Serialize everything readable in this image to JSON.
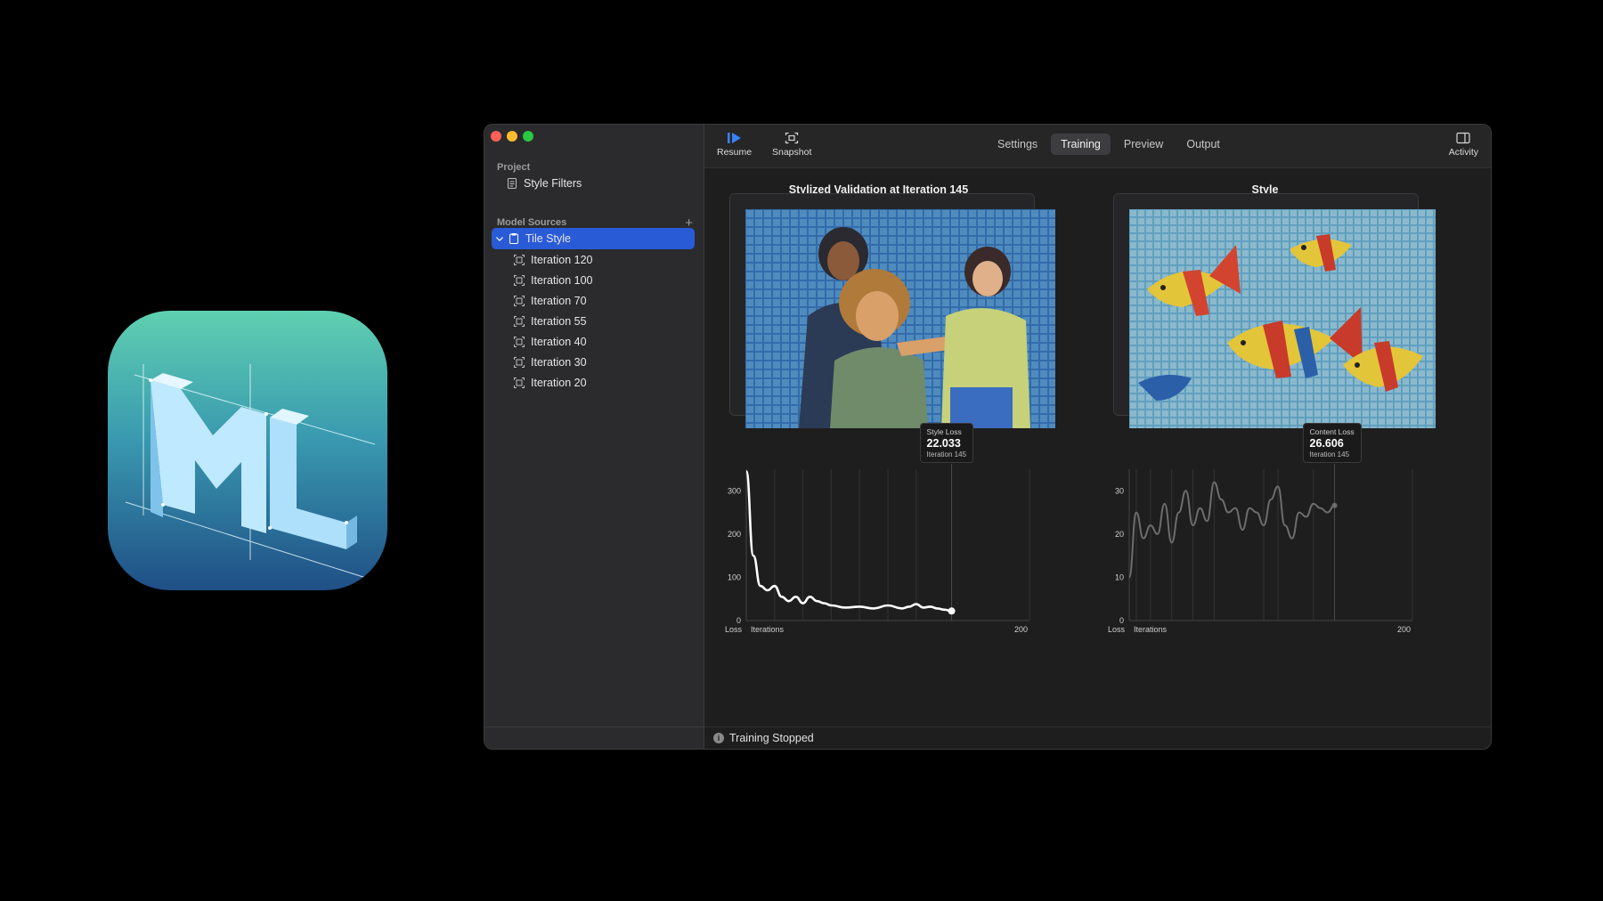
{
  "sidebar": {
    "project_header": "Project",
    "project_item": "Style Filters",
    "sources_header": "Model Sources",
    "selected_source": "Tile Style",
    "iterations": [
      "Iteration 120",
      "Iteration 100",
      "Iteration 70",
      "Iteration 55",
      "Iteration 40",
      "Iteration 30",
      "Iteration 20"
    ]
  },
  "toolbar": {
    "resume_label": "Resume",
    "snapshot_label": "Snapshot",
    "activity_label": "Activity",
    "tabs": [
      "Settings",
      "Training",
      "Preview",
      "Output"
    ],
    "active_tab": "Training",
    "accent": "#2a5bd7"
  },
  "panes": {
    "left_title": "Stylized Validation at Iteration 145",
    "right_title": "Style"
  },
  "chart_data": [
    {
      "type": "line",
      "title": "",
      "xlabel": "Iterations",
      "ylabel": "Loss",
      "xlim": [
        0,
        200
      ],
      "ylim": [
        0,
        350
      ],
      "yticks": [
        0,
        100,
        200,
        300
      ],
      "x_end_label": "200",
      "series": [
        {
          "name": "Style Loss",
          "x": [
            0,
            5,
            10,
            15,
            20,
            25,
            30,
            35,
            40,
            45,
            50,
            55,
            60,
            70,
            80,
            90,
            100,
            110,
            115,
            120,
            125,
            130,
            135,
            140,
            145
          ],
          "y": [
            345,
            150,
            80,
            70,
            80,
            55,
            45,
            55,
            40,
            55,
            45,
            40,
            35,
            30,
            32,
            28,
            35,
            28,
            32,
            38,
            30,
            32,
            28,
            25,
            22.033
          ]
        }
      ],
      "tooltip": {
        "label": "Style Loss",
        "value": "22.033",
        "sub": "Iteration 145"
      }
    },
    {
      "type": "line",
      "title": "",
      "xlabel": "Iterations",
      "ylabel": "Loss",
      "xlim": [
        0,
        200
      ],
      "ylim": [
        0,
        35
      ],
      "yticks": [
        0,
        10,
        20,
        30
      ],
      "x_end_label": "200",
      "series": [
        {
          "name": "Content Loss",
          "x": [
            0,
            5,
            10,
            15,
            20,
            25,
            30,
            35,
            40,
            45,
            50,
            55,
            60,
            65,
            70,
            75,
            80,
            85,
            90,
            95,
            100,
            105,
            110,
            115,
            120,
            125,
            130,
            135,
            140,
            145
          ],
          "y": [
            10,
            25,
            19,
            22,
            20,
            27,
            18,
            25,
            30,
            22,
            26,
            23,
            32,
            28,
            25,
            26,
            21,
            26,
            25,
            22,
            28,
            31,
            22,
            19,
            25,
            24,
            27,
            26,
            25,
            26.606
          ]
        }
      ],
      "tooltip": {
        "label": "Content Loss",
        "value": "26.606",
        "sub": "Iteration 145"
      }
    }
  ],
  "status": {
    "text": "Training Stopped"
  }
}
